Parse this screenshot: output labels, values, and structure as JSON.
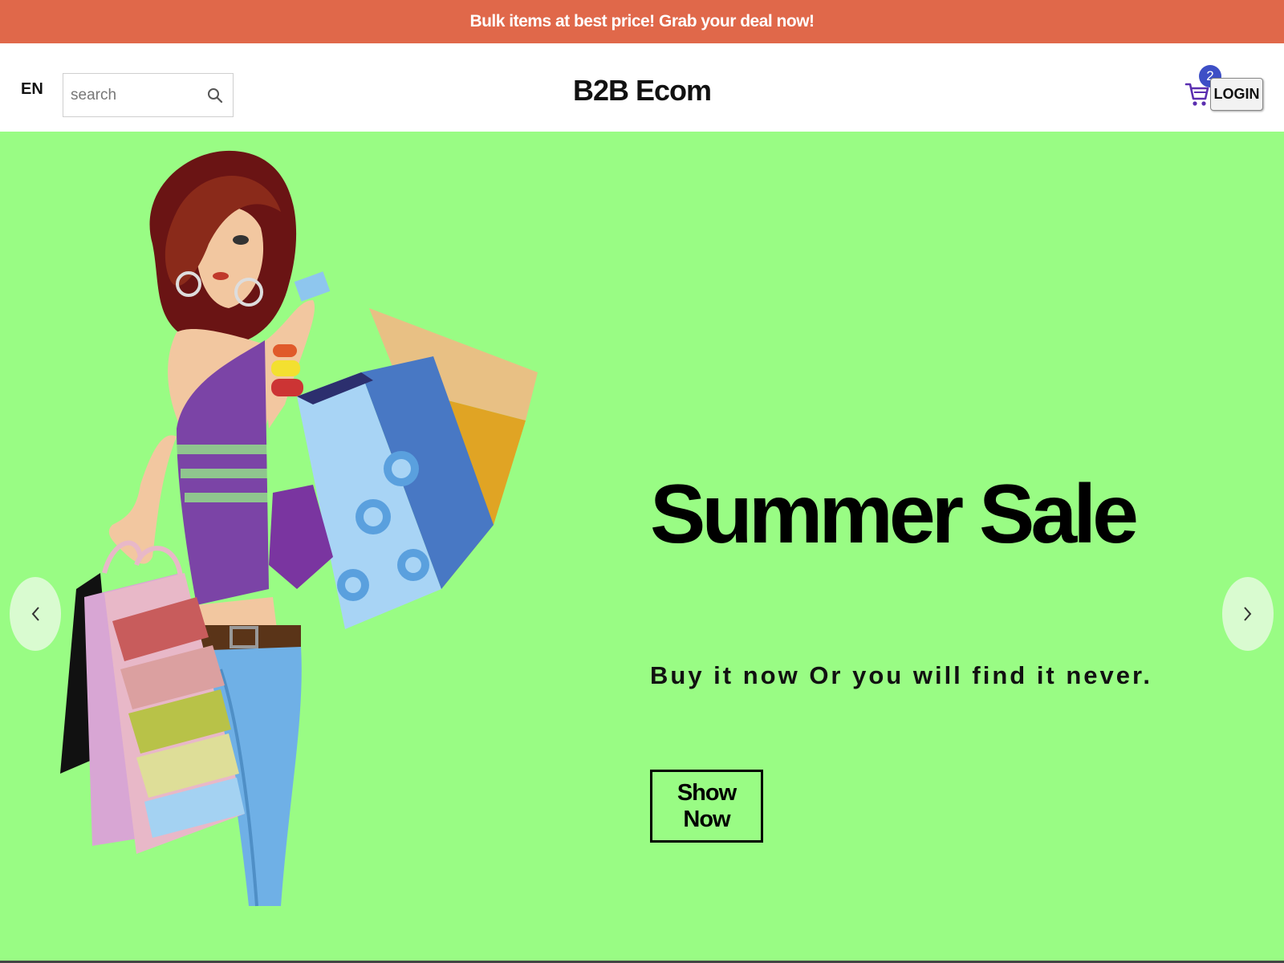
{
  "announcement": {
    "text": "Bulk items at best price!  Grab your deal now!"
  },
  "header": {
    "language": "EN",
    "search_placeholder": "search",
    "brand": "B2B Ecom",
    "cart_count": "2",
    "login_label": "LOGIN"
  },
  "hero": {
    "title": "Summer Sale",
    "subtitle": "Buy it now Or you will find it never.",
    "cta_label": "Show Now",
    "background_color": "#99fc84"
  },
  "colors": {
    "announcement_bg": "#e0684a",
    "badge": "#3d4fc6",
    "cart_icon": "#5b2fb0"
  },
  "icons": {
    "search": "search-icon",
    "cart": "cart-icon",
    "prev": "chevron-left-icon",
    "next": "chevron-right-icon"
  }
}
